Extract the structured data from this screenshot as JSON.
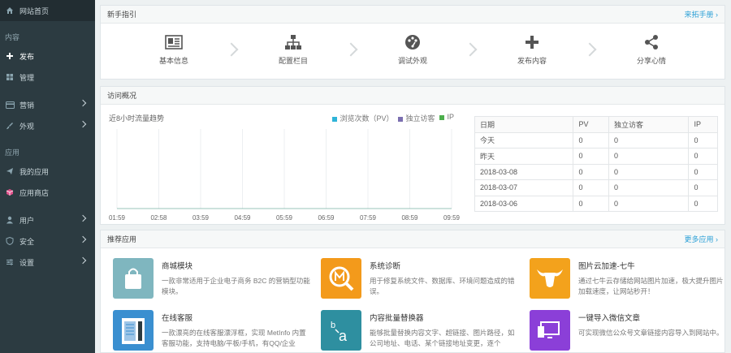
{
  "sidebar": {
    "home": "网站首页",
    "sections": [
      {
        "title": "内容",
        "items": [
          {
            "label": "发布",
            "icon": "plus-icon",
            "active": true,
            "chevron": false
          },
          {
            "label": "管理",
            "icon": "grid-icon",
            "active": false,
            "chevron": false
          }
        ]
      },
      {
        "title": "",
        "items": [
          {
            "label": "营销",
            "icon": "card-icon",
            "active": false,
            "chevron": true
          },
          {
            "label": "外观",
            "icon": "brush-icon",
            "active": false,
            "chevron": true
          }
        ]
      },
      {
        "title": "应用",
        "items": [
          {
            "label": "我的应用",
            "icon": "send-icon",
            "active": false,
            "chevron": false
          },
          {
            "label": "应用商店",
            "icon": "cube-icon",
            "active": false,
            "chevron": false
          }
        ]
      },
      {
        "title": "",
        "items": [
          {
            "label": "用户",
            "icon": "user-icon",
            "active": false,
            "chevron": true
          },
          {
            "label": "安全",
            "icon": "shield-icon",
            "active": false,
            "chevron": true
          },
          {
            "label": "设置",
            "icon": "sliders-icon",
            "active": false,
            "chevron": true
          }
        ]
      }
    ]
  },
  "guide": {
    "title": "新手指引",
    "more": "来拓手册 ›",
    "steps": [
      {
        "label": "基本信息",
        "icon": "info-card-icon"
      },
      {
        "label": "配置栏目",
        "icon": "sitemap-icon"
      },
      {
        "label": "调试外观",
        "icon": "palette-icon"
      },
      {
        "label": "发布内容",
        "icon": "plus-icon"
      },
      {
        "label": "分享心情",
        "icon": "share-icon"
      }
    ]
  },
  "visits": {
    "title": "访问概况",
    "chart_title": "近8小时流量趋势",
    "legend": [
      {
        "label": "浏览次数（PV）",
        "color": "#2fb4d8"
      },
      {
        "label": "独立访客",
        "color": "#7b6fb0"
      },
      {
        "label": "IP",
        "color": "#4cae4c"
      }
    ],
    "table": {
      "headers": [
        "日期",
        "PV",
        "独立访客",
        "IP"
      ],
      "rows": [
        [
          "今天",
          "0",
          "0",
          "0"
        ],
        [
          "昨天",
          "0",
          "0",
          "0"
        ],
        [
          "2018-03-08",
          "0",
          "0",
          "0"
        ],
        [
          "2018-03-07",
          "0",
          "0",
          "0"
        ],
        [
          "2018-03-06",
          "0",
          "0",
          "0"
        ]
      ]
    }
  },
  "chart_data": {
    "type": "line",
    "categories": [
      "01:59",
      "02:58",
      "03:59",
      "04:59",
      "05:59",
      "06:59",
      "07:59",
      "08:59",
      "09:59"
    ],
    "series": [
      {
        "name": "浏览次数（PV）",
        "values": [
          0,
          0,
          0,
          0,
          0,
          0,
          0,
          0,
          0
        ]
      },
      {
        "name": "独立访客",
        "values": [
          0,
          0,
          0,
          0,
          0,
          0,
          0,
          0,
          0
        ]
      },
      {
        "name": "IP",
        "values": [
          0,
          0,
          0,
          0,
          0,
          0,
          0,
          0,
          0
        ]
      }
    ],
    "title": "近8小时流量趋势",
    "grid": true,
    "legend": "top-right"
  },
  "apps": {
    "title": "推荐应用",
    "more": "更多应用 ›",
    "items": [
      {
        "name": "商城模块",
        "desc": "一款非常适用于企业电子商务 B2C 的营销型功能模块。",
        "color": "#7fb6bf",
        "icon": "shopping-bag-icon"
      },
      {
        "name": "系统诊断",
        "desc": "用于修复系统文件、数据库、环境问题造成的错误。",
        "color": "#f39a1b",
        "icon": "magnifier-m-icon"
      },
      {
        "name": "图片云加速-七牛",
        "desc": "通过七牛云存储给网站图片加速，极大提升图片加载速度，让网站秒开！",
        "color": "#f3a21c",
        "icon": "bull-icon"
      },
      {
        "name": "在线客服",
        "desc": "一款漂亮的在线客服漂浮框，实现 MetInfo 内置客服功能，支持电脑/平板/手机，有QQ/企业",
        "color": "#3a8fd0",
        "icon": "chat-panel-icon"
      },
      {
        "name": "内容批量替换器",
        "desc": "能够批量替换内容文字、超链接、图片路径，如公司地址、电话、某个链接地址变更，逐个",
        "color": "#2e8fa0",
        "icon": "replace-icon"
      },
      {
        "name": "一键导入微信文章",
        "desc": "可实现微信公众号文章链接内容导入到网站中。",
        "color": "#8b3fd8",
        "icon": "devices-icon"
      }
    ]
  }
}
